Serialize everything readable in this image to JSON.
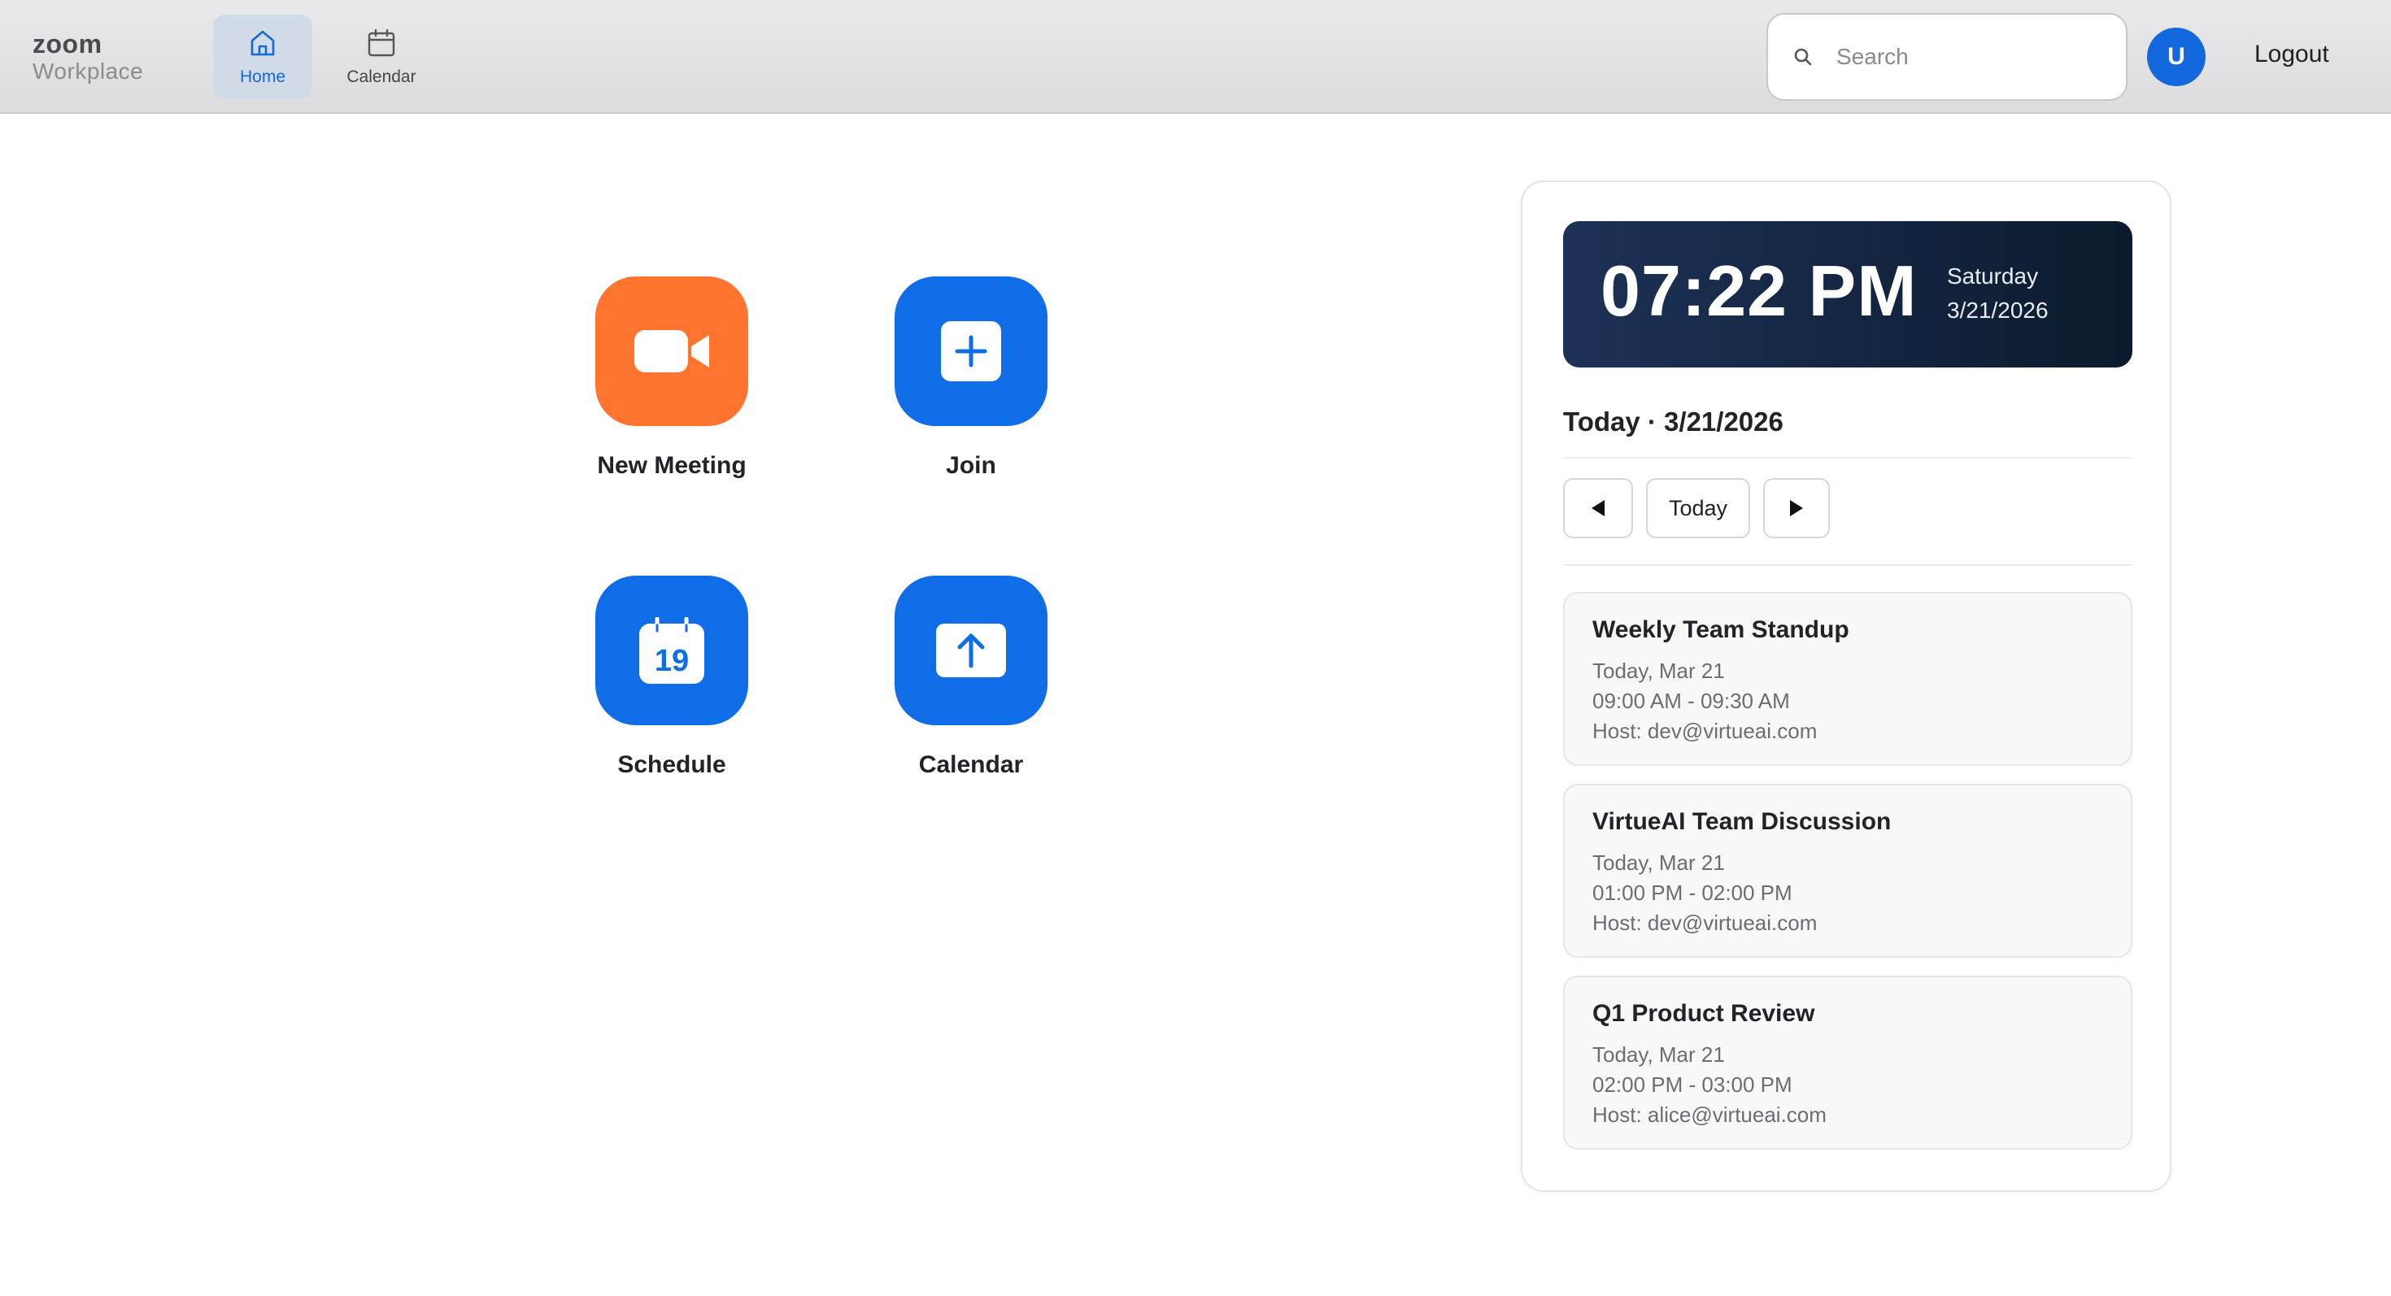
{
  "brand": {
    "name": "zoom",
    "sub": "Workplace"
  },
  "nav": {
    "home_label": "Home",
    "calendar_label": "Calendar"
  },
  "search": {
    "placeholder": "Search",
    "value": ""
  },
  "user": {
    "avatar_initial": "U",
    "logout_label": "Logout"
  },
  "actions": {
    "new_meeting": "New Meeting",
    "join": "Join",
    "schedule": "Schedule",
    "schedule_icon_day": "19",
    "calendar": "Calendar"
  },
  "clock": {
    "time": "07:22 PM",
    "day": "Saturday",
    "date": "3/21/2026"
  },
  "panel": {
    "today_heading": "Today · 3/21/2026",
    "today_button": "Today"
  },
  "events": [
    {
      "title": "Weekly Team Standup",
      "date": "Today, Mar 21",
      "time": "09:00 AM - 09:30 AM",
      "host": "Host: dev@virtueai.com"
    },
    {
      "title": "VirtueAI Team Discussion",
      "date": "Today, Mar 21",
      "time": "01:00 PM - 02:00 PM",
      "host": "Host: dev@virtueai.com"
    },
    {
      "title": "Q1 Product Review",
      "date": "Today, Mar 21",
      "time": "02:00 PM - 03:00 PM",
      "host": "Host: alice@virtueai.com"
    }
  ],
  "colors": {
    "accent_blue": "#0f6de8",
    "orange": "#ff742e",
    "clock_bg": "#1d3257"
  }
}
